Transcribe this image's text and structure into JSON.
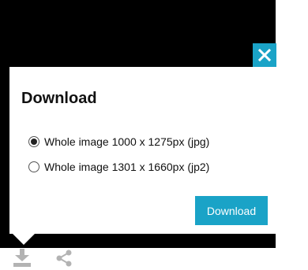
{
  "dialog": {
    "title": "Download",
    "options": [
      {
        "label": "Whole image 1000 x 1275px (jpg)",
        "selected": true
      },
      {
        "label": "Whole image 1301 x 1660px (jp2)",
        "selected": false
      }
    ],
    "download_label": "Download",
    "close_icon": "close-icon"
  },
  "toolbar": {
    "icons": [
      "download-icon",
      "share-icon"
    ]
  },
  "colors": {
    "accent": "#1aa3c7",
    "backdrop": "#000000",
    "icon_gray": "#b3b3b3"
  }
}
